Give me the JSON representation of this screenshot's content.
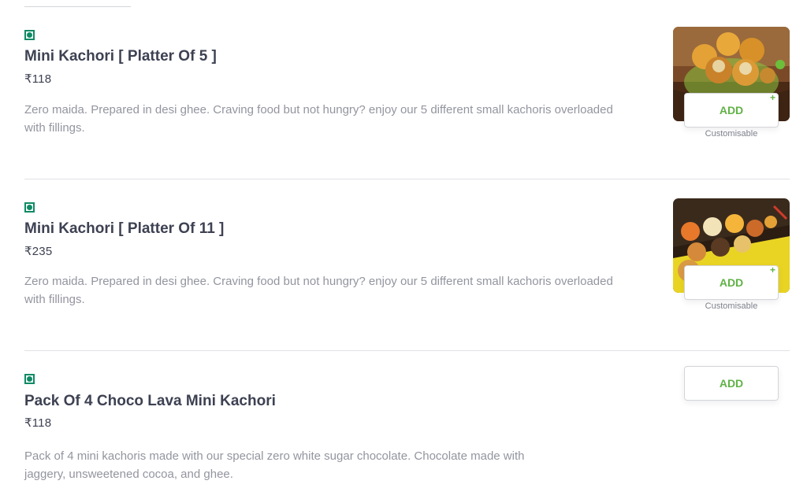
{
  "menu": {
    "items": [
      {
        "name": "Mini Kachori [ Platter Of 5 ]",
        "price": "₹118",
        "description": "Zero maida. Prepared in desi ghee. Craving food but not hungry? enjoy our 5 different small kachoris overloaded with fillings.",
        "add_label": "ADD",
        "add_plus": "+",
        "customisable": "Customisable",
        "veg": true
      },
      {
        "name": "Mini Kachori [ Platter Of 11 ]",
        "price": "₹235",
        "description": "Zero maida. Prepared in desi ghee. Craving food but not hungry? enjoy our 5 different small kachoris overloaded with fillings.",
        "add_label": "ADD",
        "add_plus": "+",
        "customisable": "Customisable",
        "veg": true
      },
      {
        "name": "Pack Of 4 Choco Lava Mini Kachori",
        "price": "₹118",
        "description": "Pack of 4 mini kachoris made with our special zero white sugar chocolate. Chocolate made with jaggery, unsweetened cocoa, and ghee.",
        "add_label": "ADD",
        "veg": true
      }
    ]
  },
  "colors": {
    "veg_green": "#0f8a65",
    "add_green": "#60b246",
    "text_dark": "#3d4152",
    "text_muted": "#93959f"
  }
}
